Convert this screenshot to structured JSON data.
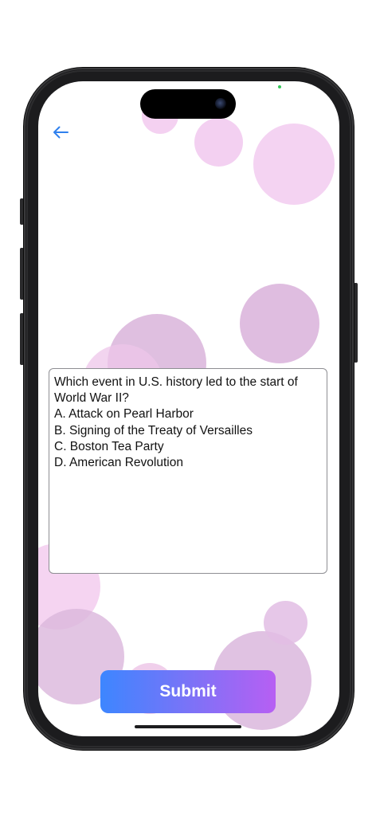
{
  "navigation": {
    "back_icon": "arrow-left-icon"
  },
  "question": {
    "text": "Which event in U.S. history led to the start of World War II?\nA. Attack on Pearl Harbor\nB. Signing of the Treaty of Versailles\nC. Boston Tea Party\nD. American Revolution"
  },
  "actions": {
    "submit_label": "Submit"
  },
  "colors": {
    "accent_blue": "#3d86ff",
    "accent_purple": "#b75ff3",
    "bubble_pink": "#f0c8ee",
    "bubble_mauve": "#d7b5dc",
    "back_arrow": "#2f80ed"
  }
}
